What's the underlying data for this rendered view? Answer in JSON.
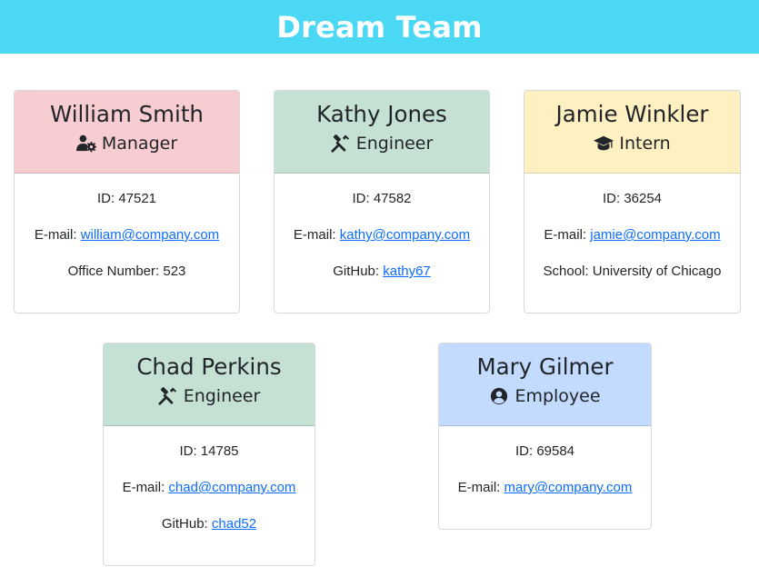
{
  "header": {
    "title": "Dream Team"
  },
  "labels": {
    "id": "ID: ",
    "email": "E-mail: ",
    "office": "Office Number: ",
    "github": "GitHub: ",
    "school": "School: "
  },
  "colors": {
    "banner": "#4bd8f4",
    "manager": "#f8cdd2",
    "engineer": "#c5e1d4",
    "intern": "#fff0c2",
    "employee": "#c3dbfe",
    "link": "#0d6efd"
  },
  "team": [
    {
      "name": "William Smith",
      "role": "Manager",
      "icon": "user-cog-icon",
      "id": "47521",
      "email": "william@company.com",
      "office": "523"
    },
    {
      "name": "Kathy Jones",
      "role": "Engineer",
      "icon": "tools-icon",
      "id": "47582",
      "email": "kathy@company.com",
      "github": "kathy67"
    },
    {
      "name": "Jamie Winkler",
      "role": "Intern",
      "icon": "graduation-cap-icon",
      "id": "36254",
      "email": "jamie@company.com",
      "school": "University of Chicago"
    },
    {
      "name": "Chad Perkins",
      "role": "Engineer",
      "icon": "tools-icon",
      "id": "14785",
      "email": "chad@company.com",
      "github": "chad52"
    },
    {
      "name": "Mary Gilmer",
      "role": "Employee",
      "icon": "user-circle-icon",
      "id": "69584",
      "email": "mary@company.com"
    }
  ]
}
